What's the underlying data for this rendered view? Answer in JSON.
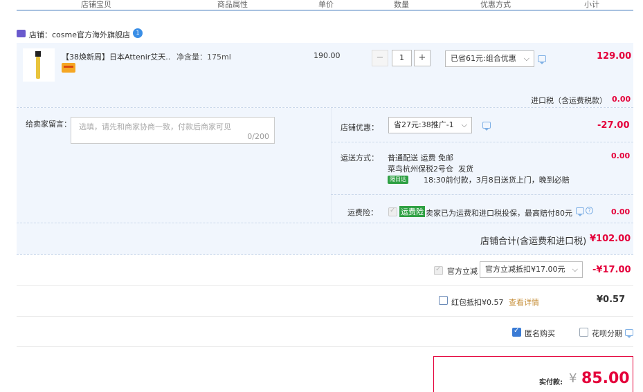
{
  "header": {
    "col_item": "店铺宝贝",
    "col_attr": "商品属性",
    "col_price": "单价",
    "col_qty": "数量",
    "col_discount": "优惠方式",
    "col_subtotal": "小计"
  },
  "shop": {
    "label": "店铺：",
    "name": "cosme官方海外旗舰店",
    "badge": "1"
  },
  "product": {
    "title": "【38焕新周】日本Attenir艾天...",
    "attr": "净含量：175ml",
    "price": "190.00",
    "quantity": "1",
    "qty_minus": "−",
    "qty_plus": "+",
    "discount_select": "已省61元:组合优惠",
    "subtotal": "129.00"
  },
  "import_tax": {
    "label": "进口税（含运费税款）",
    "value": "0.00"
  },
  "message": {
    "label": "给卖家留言：",
    "placeholder": "选填，请先和商家协商一致，付款后商家可见",
    "counter": "0/200"
  },
  "shop_discount": {
    "label": "店铺优惠：",
    "select": "省27元:38推广-1",
    "value": "-27.00"
  },
  "shipping": {
    "label": "运送方式：",
    "method": "普通配送 运费 免邮",
    "warehouse": "菜鸟杭州保税2号仓",
    "ship_text": "发货",
    "badge": "隔日达",
    "time_note": "18:30前付款，3月8日送货上门，晚到必赔",
    "value": "0.00"
  },
  "insurance": {
    "label": "运费险：",
    "tag": "运费险",
    "text": "卖家已为运费和进口税投保，最高赔付80元",
    "value": "0.00"
  },
  "shop_total": {
    "label": "店铺合计(含运费和进口税)",
    "value": "¥102.00"
  },
  "official_discount": {
    "label": "官方立减",
    "select": "官方立减抵扣¥17.00元",
    "value": "-¥17.00"
  },
  "red_packet": {
    "label": "红包抵扣¥0.57",
    "link": "查看详情",
    "value": "¥0.57"
  },
  "options": {
    "anonymous": "匿名购买",
    "huabei": "花呗分期"
  },
  "payment": {
    "label": "实付款:",
    "currency": "¥",
    "amount": "85.00"
  },
  "colors": {
    "accent_red": "#e4003a",
    "blue_border": "#a8c2e0",
    "row_bg": "#f1f6fd",
    "green_badge": "#2ea043"
  }
}
